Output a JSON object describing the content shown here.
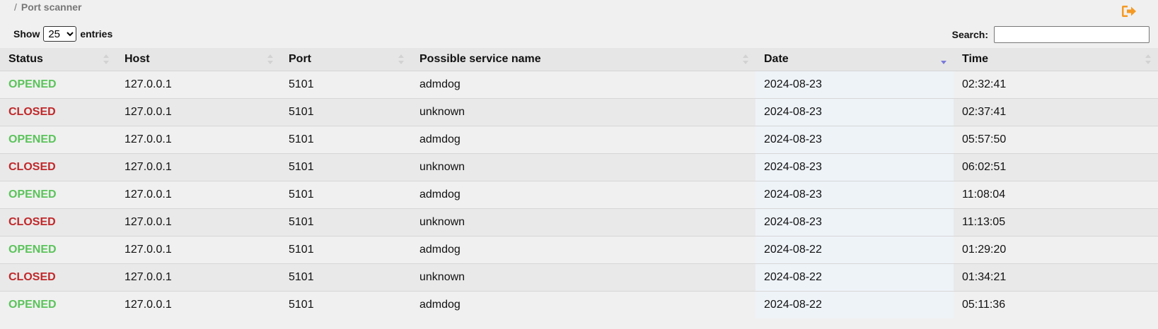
{
  "breadcrumb": {
    "separator": "/",
    "current": "Port scanner"
  },
  "icons": {
    "logout": "sign-out-icon",
    "logout_color": "#f59a23"
  },
  "length_control": {
    "show_label": "Show",
    "selected": "25",
    "entries_label": "entries"
  },
  "search": {
    "label": "Search:",
    "value": "",
    "placeholder": ""
  },
  "table": {
    "columns": [
      "Status",
      "Host",
      "Port",
      "Possible service name",
      "Date",
      "Time"
    ],
    "sorted_column": "Date",
    "sort_direction": "descending",
    "status_colors": {
      "OPENED": "#5bc35b",
      "CLOSED": "#c0282a"
    },
    "rows": [
      [
        "OPENED",
        "127.0.0.1",
        "5101",
        "admdog",
        "2024-08-23",
        "02:32:41"
      ],
      [
        "CLOSED",
        "127.0.0.1",
        "5101",
        "unknown",
        "2024-08-23",
        "02:37:41"
      ],
      [
        "OPENED",
        "127.0.0.1",
        "5101",
        "admdog",
        "2024-08-23",
        "05:57:50"
      ],
      [
        "CLOSED",
        "127.0.0.1",
        "5101",
        "unknown",
        "2024-08-23",
        "06:02:51"
      ],
      [
        "OPENED",
        "127.0.0.1",
        "5101",
        "admdog",
        "2024-08-23",
        "11:08:04"
      ],
      [
        "CLOSED",
        "127.0.0.1",
        "5101",
        "unknown",
        "2024-08-23",
        "11:13:05"
      ],
      [
        "OPENED",
        "127.0.0.1",
        "5101",
        "admdog",
        "2024-08-22",
        "01:29:20"
      ],
      [
        "CLOSED",
        "127.0.0.1",
        "5101",
        "unknown",
        "2024-08-22",
        "01:34:21"
      ],
      [
        "OPENED",
        "127.0.0.1",
        "5101",
        "admdog",
        "2024-08-22",
        "05:11:36"
      ]
    ]
  }
}
